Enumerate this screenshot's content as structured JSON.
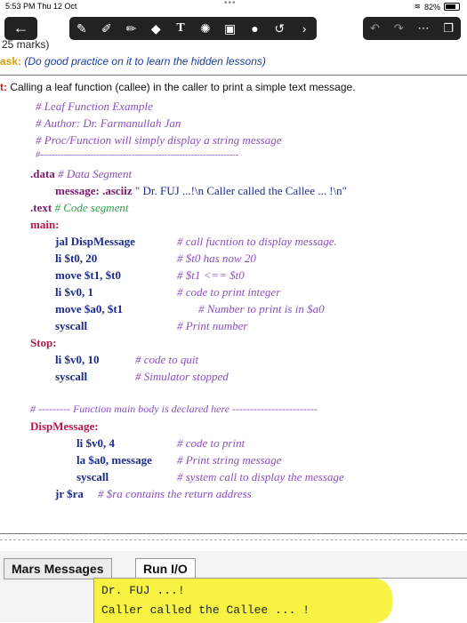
{
  "status": {
    "time": "5:53 PM   Thu 12 Oct",
    "battery": "82%",
    "battery_level": 0.82
  },
  "toolbar": {
    "back": "←",
    "center_icons": [
      "pen-icon",
      "pencil-icon",
      "marker-icon",
      "eraser-icon",
      "text-icon",
      "shape-icon",
      "image-icon",
      "mic-icon",
      "lasso-icon",
      "chevron-right-icon"
    ],
    "text_tool": "T",
    "right_icons": [
      "undo-icon",
      "redo-icon",
      "more-icon",
      "pages-icon"
    ]
  },
  "header": {
    "marks": "25 marks)",
    "task_label": "ask:",
    "task_text": " (Do good practice on it to learn the hidden lessons)",
    "title_label": "t:",
    "title_text": " Calling a leaf function (callee) in the caller to print a simple text message."
  },
  "code": {
    "c1": "# Leaf Function Example",
    "c2": "# Author: Dr. Farmanullah Jan",
    "c3": "# Proc/Function will simply display a string message",
    "c4": "#-------------------------------------------------------------------",
    "data_dir": ".data",
    "data_cm": " # Data Segment",
    "msg_lab": "message:",
    "msg_dir": " .asciiz",
    "msg_str": " \" Dr. FUJ ...!\\n Caller called the Callee ... !\\n\"",
    "text_dir": ".text",
    "text_cm": " # Code segment",
    "main_lab": "main:",
    "l1": "jal DispMessage",
    "l1c": "# call fucntion to display message.",
    "l2": "li $t0, 20",
    "l2c": "# $t0 has now 20",
    "l3": "move $t1, $t0",
    "l3c": "# $t1 <== $t0",
    "l4": "li $v0, 1",
    "l4c": "# code to print integer",
    "l5": "move $a0, $t1",
    "l5c": "# Number to print is in $a0",
    "l6": "syscall",
    "l6c": "# Print number",
    "stop_lab": "Stop:",
    "s1": "li $v0, 10",
    "s1c": "# code to quit",
    "s2": "syscall",
    "s2c": "# Simulator stopped",
    "sep": "# --------- Function main body is declared here ------------------------",
    "disp_lab": "DispMessage:",
    "d1": "li $v0, 4",
    "d1c": "# code to print",
    "d2": "la $a0, message",
    "d2c": "# Print string message",
    "d3": "syscall",
    "d3c": "# system call to display the message",
    "d4": "jr $ra",
    "d4c": "# $ra contains the return address"
  },
  "mars": {
    "tab_messages": "Mars Messages",
    "tab_runio": "Run I/O",
    "out1": "Dr. FUJ ...!",
    "out2": "Caller called the Callee ... !"
  }
}
